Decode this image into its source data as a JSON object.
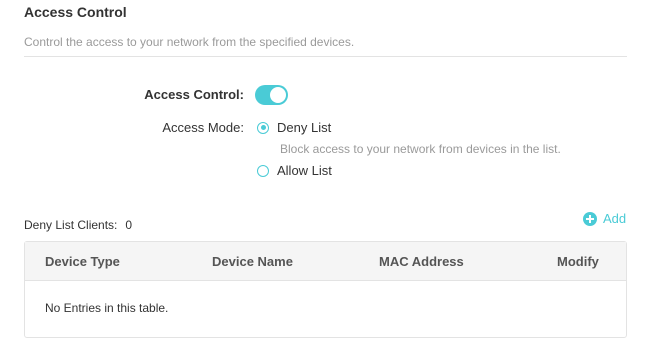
{
  "section": {
    "title": "Access Control",
    "description": "Control the access to your network from the specified devices."
  },
  "access_control": {
    "label": "Access Control:",
    "enabled": true
  },
  "access_mode": {
    "label": "Access Mode:",
    "options": [
      {
        "label": "Deny List",
        "checked": true,
        "hint": "Block access to your network from devices in the list."
      },
      {
        "label": "Allow List",
        "checked": false
      }
    ]
  },
  "clients": {
    "label": "Deny List Clients:",
    "count": "0",
    "add_label": "Add"
  },
  "table": {
    "columns": [
      "Device Type",
      "Device Name",
      "MAC Address",
      "Modify"
    ],
    "empty_text": "No Entries in this table."
  },
  "colors": {
    "accent": "#4acbd6",
    "muted_text": "#9a9a9a",
    "header_bg": "#f5f5f5"
  },
  "icons": {
    "add": "plus-circle-icon"
  }
}
